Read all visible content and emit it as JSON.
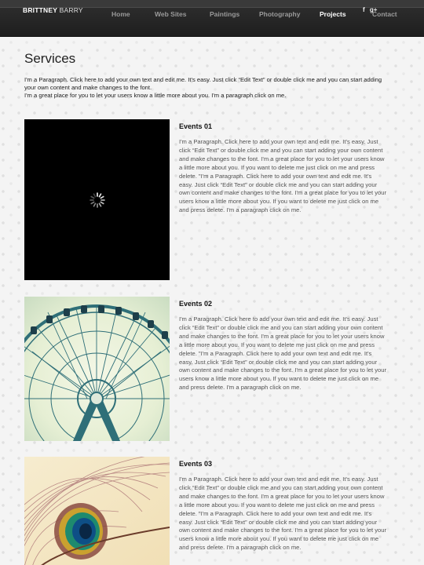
{
  "header": {
    "brand_first": "BRITTNEY",
    "brand_last": "BARRY",
    "nav": [
      "Home",
      "Web Sites",
      "Paintings",
      "Photography",
      "Projects",
      "Contact"
    ],
    "active_nav": "Projects",
    "social": {
      "facebook": "f",
      "googleplus": "g+"
    }
  },
  "main": {
    "title": "Services",
    "intro_line1": "I'm a Paragraph. Click here to add your own text and edit me. It's easy. Just click “Edit Text” or double click me and you can start adding your own content and make changes to the font.",
    "intro_line2": "I'm a great place for you to let your users know a little more about you. I'm a paragraph click on me.",
    "events": [
      {
        "title": "Events 01",
        "text": "I'm a Paragraph. Click here to add your own text and edit me. It's easy. Just click “Edit Text” or double click me and you can start adding your own content and make changes to the font. I'm a great place for you to let your users know a little more about you. If you want to delete me just click on me and press delete. \"I'm a Paragraph. Click here to add your own text and edit me. It's easy. Just click “Edit Text” or double click me and you can start adding your own content and make changes to the font. I'm a great place for you to let your users know a little more about you. If you want to delete me just click on me and press delete. I'm a paragraph click on me.",
        "image": "loading-placeholder"
      },
      {
        "title": "Events 02",
        "text": "I'm a Paragraph. Click here to add your own text and edit me. It's easy. Just click “Edit Text” or double click me and you can start adding your own content and make changes to the font. I'm a great place for you to let your users know a little more about you. If you want to delete me just click on me and press delete. \"I'm a Paragraph. Click here to add your own text and edit me. It's easy. Just click “Edit Text” or double click me and you can start adding your own content and make changes to the font. I'm a great place for you to let your users know a little more about you. If you want to delete me just click on me and press delete. I'm a paragraph click on me.",
        "image": "ferris-wheel-photo"
      },
      {
        "title": "Events 03",
        "text": "I'm a Paragraph. Click here to add your own text and edit me. It's easy. Just click “Edit Text” or double click me and you can start adding your own content and make changes to the font. I'm a great place for you to let your users know a little more about you. If you want to delete me just click on me and press delete. \"I'm a Paragraph. Click here to add your own text and edit me. It's easy. Just click “Edit Text” or double click me and you can start adding your own content and make changes to the font. I'm a great place for you to let your users know a little more about you. If you want to delete me just click on me and press delete. I'm a paragraph click on me.",
        "image": "peacock-feather-photo"
      }
    ]
  },
  "colors": {
    "header_bg": "#262626",
    "nav_text": "#9a9a9a",
    "nav_active": "#ffffff",
    "body_text": "#555555",
    "title_text": "#222222"
  }
}
